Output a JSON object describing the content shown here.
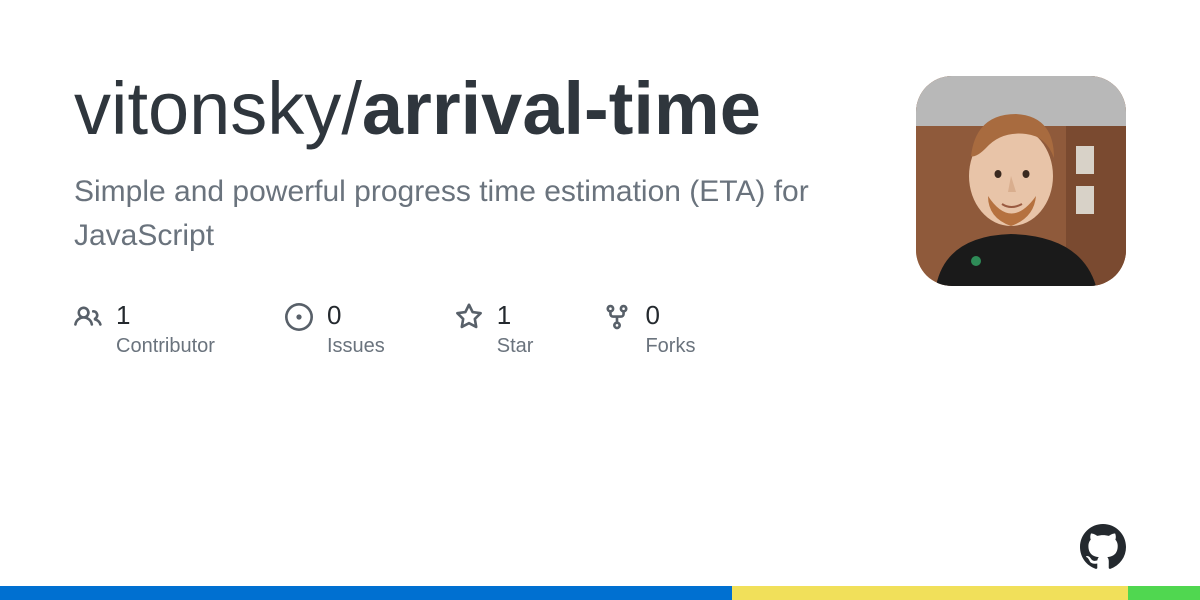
{
  "repo": {
    "owner": "vitonsky",
    "separator": "/",
    "name": "arrival-time",
    "description": "Simple and powerful progress time estimation (ETA) for JavaScript"
  },
  "stats": [
    {
      "icon": "people-icon",
      "count": "1",
      "label": "Contributor"
    },
    {
      "icon": "issue-icon",
      "count": "0",
      "label": "Issues"
    },
    {
      "icon": "star-icon",
      "count": "1",
      "label": "Star"
    },
    {
      "icon": "fork-icon",
      "count": "0",
      "label": "Forks"
    }
  ],
  "accent_segments": [
    {
      "color": "#0070d1",
      "flex": 61
    },
    {
      "color": "#f1e05a",
      "flex": 33
    },
    {
      "color": "#50d750",
      "flex": 6
    }
  ]
}
